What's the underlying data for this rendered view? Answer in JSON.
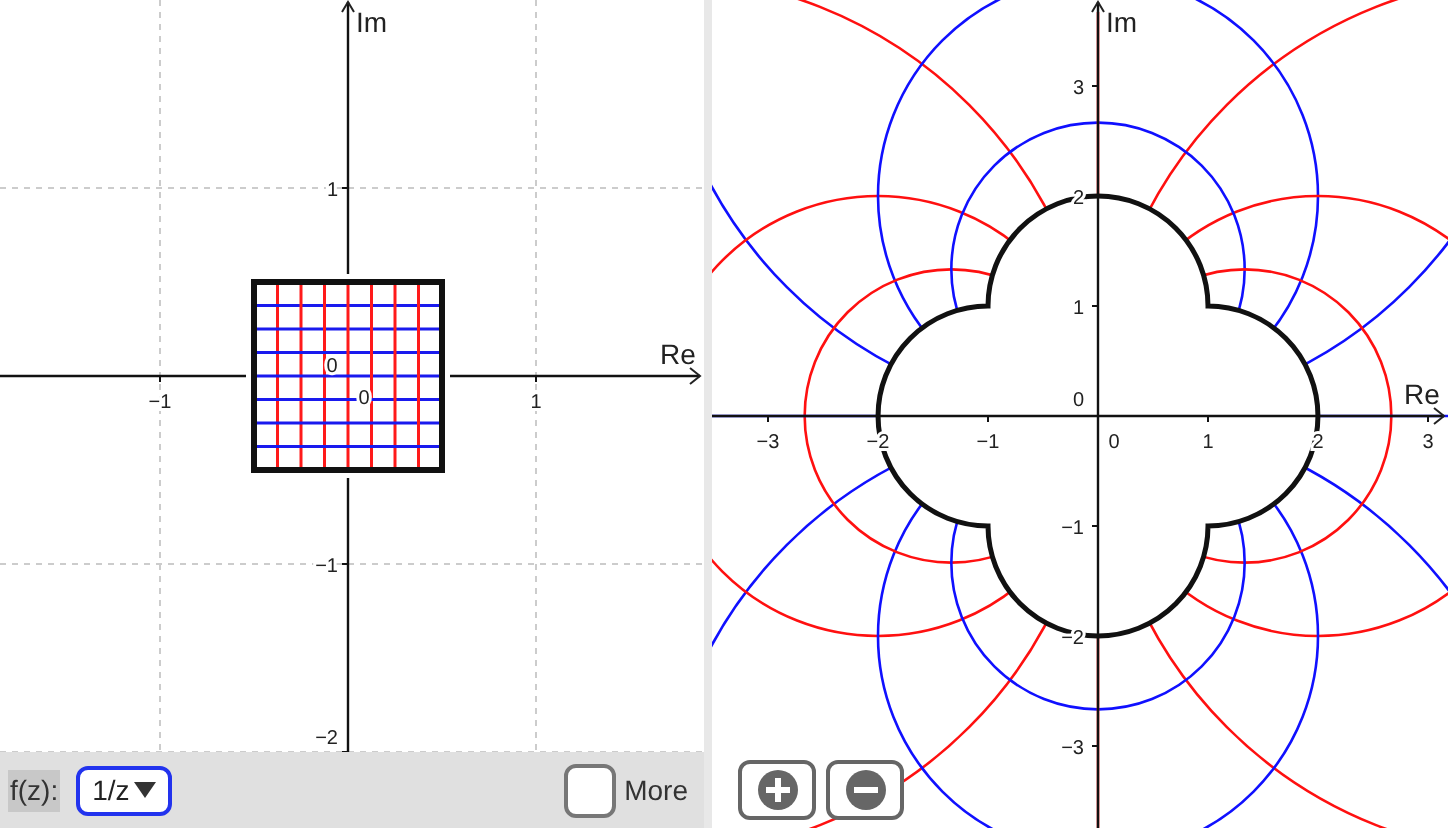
{
  "domain_plane": {
    "axis_labels": [
      "Re",
      "Im"
    ],
    "x_ticks": [
      "−1",
      "1"
    ],
    "y_ticks": [
      "1",
      "−1",
      "−2"
    ],
    "origin_labels": [
      "0",
      "0"
    ]
  },
  "image_plane": {
    "axis_labels": [
      "Re",
      "Im"
    ],
    "x_ticks": [
      "−3",
      "−2",
      "−1",
      "0",
      "1",
      "2",
      "3"
    ],
    "y_ticks": [
      "3",
      "2",
      "1",
      "0",
      "−1",
      "−2",
      "−3"
    ]
  },
  "toolbar": {
    "function_label": "f(z):",
    "function_select": "1/z",
    "more_checkbox": {
      "label": "More",
      "checked": false
    }
  }
}
